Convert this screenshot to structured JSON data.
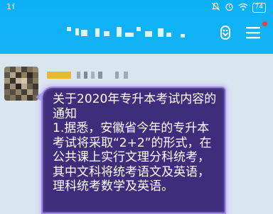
{
  "status_bar": {
    "signal_text": "1ſ",
    "battery": "74"
  },
  "header": {
    "title": ""
  },
  "chat": {
    "message": {
      "text": "关于2020年专升本考试内容的通知\n1.据悉，安徽省今年的专升本考试将采取“2+2”的形式，在公共课上实行文理分科统考，其中文科将统考语文及英语，理科统考数学及英语。"
    }
  },
  "colors": {
    "header_bg": "#0bb0f6",
    "chat_bg": "#d9e5ef",
    "bubble_bg": "#3d2d7a",
    "bubble_glow": "#c8b4ff",
    "notification_dot": "#ff3b30"
  },
  "icons": {
    "mute": "bell-slash-icon",
    "alarm": "alarm-icon",
    "wifi": "wifi-icon",
    "battery": "battery-icon",
    "group_members": "group-members-icon",
    "menu": "menu-icon"
  }
}
